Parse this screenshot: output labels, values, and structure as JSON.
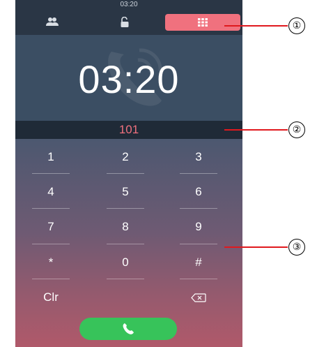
{
  "status_bar": {
    "time": "03:20"
  },
  "tabs": [
    {
      "icon": "contacts-icon"
    },
    {
      "icon": "unlock-icon"
    },
    {
      "icon": "keypad-icon",
      "active": true
    }
  ],
  "call": {
    "timer": "03:20",
    "dialed_number": "101"
  },
  "keypad": {
    "keys": [
      "1",
      "2",
      "3",
      "4",
      "5",
      "6",
      "7",
      "8",
      "9",
      "*",
      "0",
      "#"
    ],
    "clear_label": "Clr",
    "backspace_icon": "backspace-icon"
  },
  "call_button": {
    "icon": "phone-icon",
    "color": "#37c35a"
  },
  "callouts": [
    "①",
    "②",
    "③"
  ],
  "colors": {
    "accent": "#f0717e",
    "call_green": "#37c35a",
    "callout_line": "#e0191e"
  }
}
